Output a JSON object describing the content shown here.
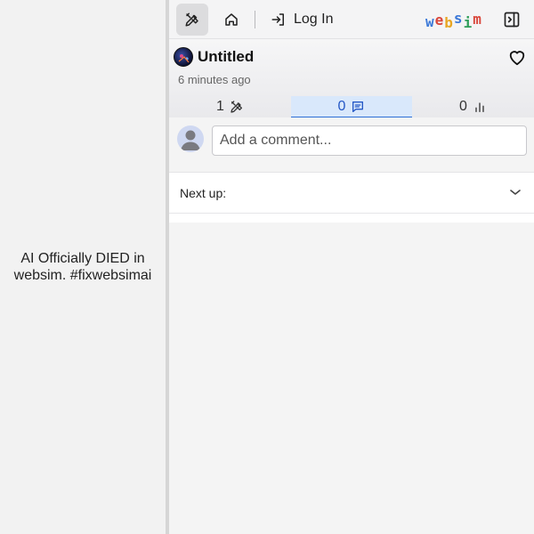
{
  "site": {
    "text": "AI Officially DIED in websim. #fixwebsimai"
  },
  "topbar": {
    "login_label": "Log In",
    "logo_letters": [
      {
        "char": "w",
        "color": "#3b78d8"
      },
      {
        "char": "e",
        "color": "#d9463b"
      },
      {
        "char": "b",
        "color": "#e8a623"
      },
      {
        "char": "s",
        "color": "#3b78d8"
      },
      {
        "char": "i",
        "color": "#2f9e5a"
      },
      {
        "char": "m",
        "color": "#d9463b"
      }
    ],
    "icons": [
      "edit-tools-icon",
      "home-icon",
      "login-icon",
      "side-panel-icon"
    ]
  },
  "project": {
    "title": "Untitled",
    "time": "6 minutes ago"
  },
  "tabs": [
    {
      "count": "1",
      "icon": "edit-tools-icon"
    },
    {
      "count": "0",
      "icon": "comment-icon"
    },
    {
      "count": "0",
      "icon": "stats-icon"
    }
  ],
  "comment": {
    "placeholder": "Add a comment..."
  },
  "next_up": {
    "label": "Next up:"
  },
  "colors": {
    "accent": "#2d6fd6",
    "active_tab_bg": "#d9e8fb"
  }
}
